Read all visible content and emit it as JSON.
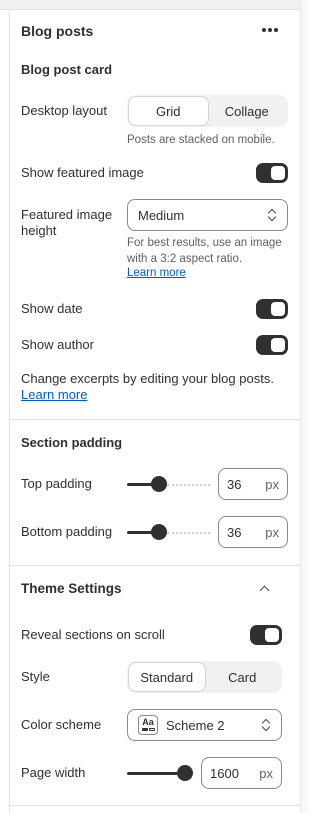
{
  "blog_posts": {
    "title": "Blog posts",
    "card_title": "Blog post card",
    "desktop_layout": {
      "label": "Desktop layout",
      "options": [
        "Grid",
        "Collage"
      ],
      "selected": "Grid",
      "hint": "Posts are stacked on mobile."
    },
    "show_featured_image": {
      "label": "Show featured image",
      "value": true
    },
    "featured_image_height": {
      "label_line1": "Featured image",
      "label_line2": "height",
      "value": "Medium",
      "hint_line1": "For best results, use an image",
      "hint_line2": "with a 3:2 aspect ratio.",
      "learn_more": "Learn more"
    },
    "show_date": {
      "label": "Show date",
      "value": true
    },
    "show_author": {
      "label": "Show author",
      "value": true
    },
    "excerpts_note": "Change excerpts by editing your blog posts.",
    "excerpts_learn_more": "Learn more"
  },
  "section_padding": {
    "title": "Section padding",
    "top": {
      "label": "Top padding",
      "value": "36",
      "unit": "px",
      "fraction": 0.36
    },
    "bottom": {
      "label": "Bottom padding",
      "value": "36",
      "unit": "px",
      "fraction": 0.36
    }
  },
  "theme_settings": {
    "title": "Theme Settings",
    "reveal": {
      "label": "Reveal sections on scroll",
      "value": true
    },
    "style": {
      "label": "Style",
      "options": [
        "Standard",
        "Card"
      ],
      "selected": "Standard"
    },
    "color_scheme": {
      "label": "Color scheme",
      "value": "Scheme 2",
      "icon_text": "Aa"
    },
    "page_width": {
      "label": "Page width",
      "value": "1600",
      "unit": "px",
      "fraction": 1.0
    }
  },
  "icons": {
    "more": "more-horizontal-icon",
    "collapse": "chevron-up-icon",
    "select": "select-chevron-icon"
  }
}
